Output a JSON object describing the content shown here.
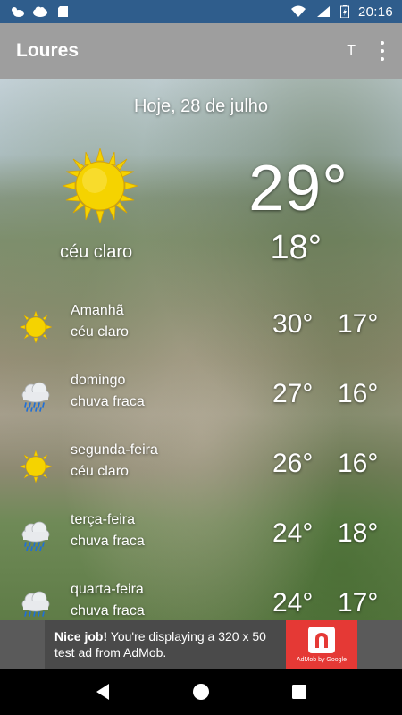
{
  "status_bar": {
    "time": "20:16",
    "left_icons": [
      "cloud-sun-icon",
      "cloud-icon",
      "sd-card-icon"
    ],
    "right_icons": [
      "wifi-icon",
      "signal-icon",
      "battery-charging-icon"
    ]
  },
  "action_bar": {
    "title": "Loures",
    "t_button": "T",
    "more_icon": "more-vert-icon"
  },
  "today": {
    "date_label": "Hoje, 28 de julho",
    "condition": "céu claro",
    "icon": "sun-icon",
    "current_temp": "29°",
    "min_temp": "18°"
  },
  "forecast": [
    {
      "day": "Amanhã",
      "condition": "céu claro",
      "icon": "sun-icon",
      "max": "30°",
      "min": "17°"
    },
    {
      "day": "domingo",
      "condition": "chuva fraca",
      "icon": "rain-cloud-icon",
      "max": "27°",
      "min": "16°"
    },
    {
      "day": "segunda-feira",
      "condition": "céu claro",
      "icon": "sun-icon",
      "max": "26°",
      "min": "16°"
    },
    {
      "day": "terça-feira",
      "condition": "chuva fraca",
      "icon": "rain-cloud-icon",
      "max": "24°",
      "min": "18°"
    },
    {
      "day": "quarta-feira",
      "condition": "chuva fraca",
      "icon": "rain-cloud-icon",
      "max": "24°",
      "min": "17°"
    }
  ],
  "ad": {
    "headline": "Nice job!",
    "body": "You're displaying a 320 x 50 test ad from AdMob.",
    "badge": "AdMob by Google"
  },
  "nav": {
    "back_icon": "back-icon",
    "home_icon": "home-icon",
    "recents_icon": "recents-icon"
  },
  "colors": {
    "status_bar": "#2f5d8c",
    "action_bar": "#9e9e9e",
    "sun": "#f5d300",
    "ad_accent": "#e53935"
  }
}
